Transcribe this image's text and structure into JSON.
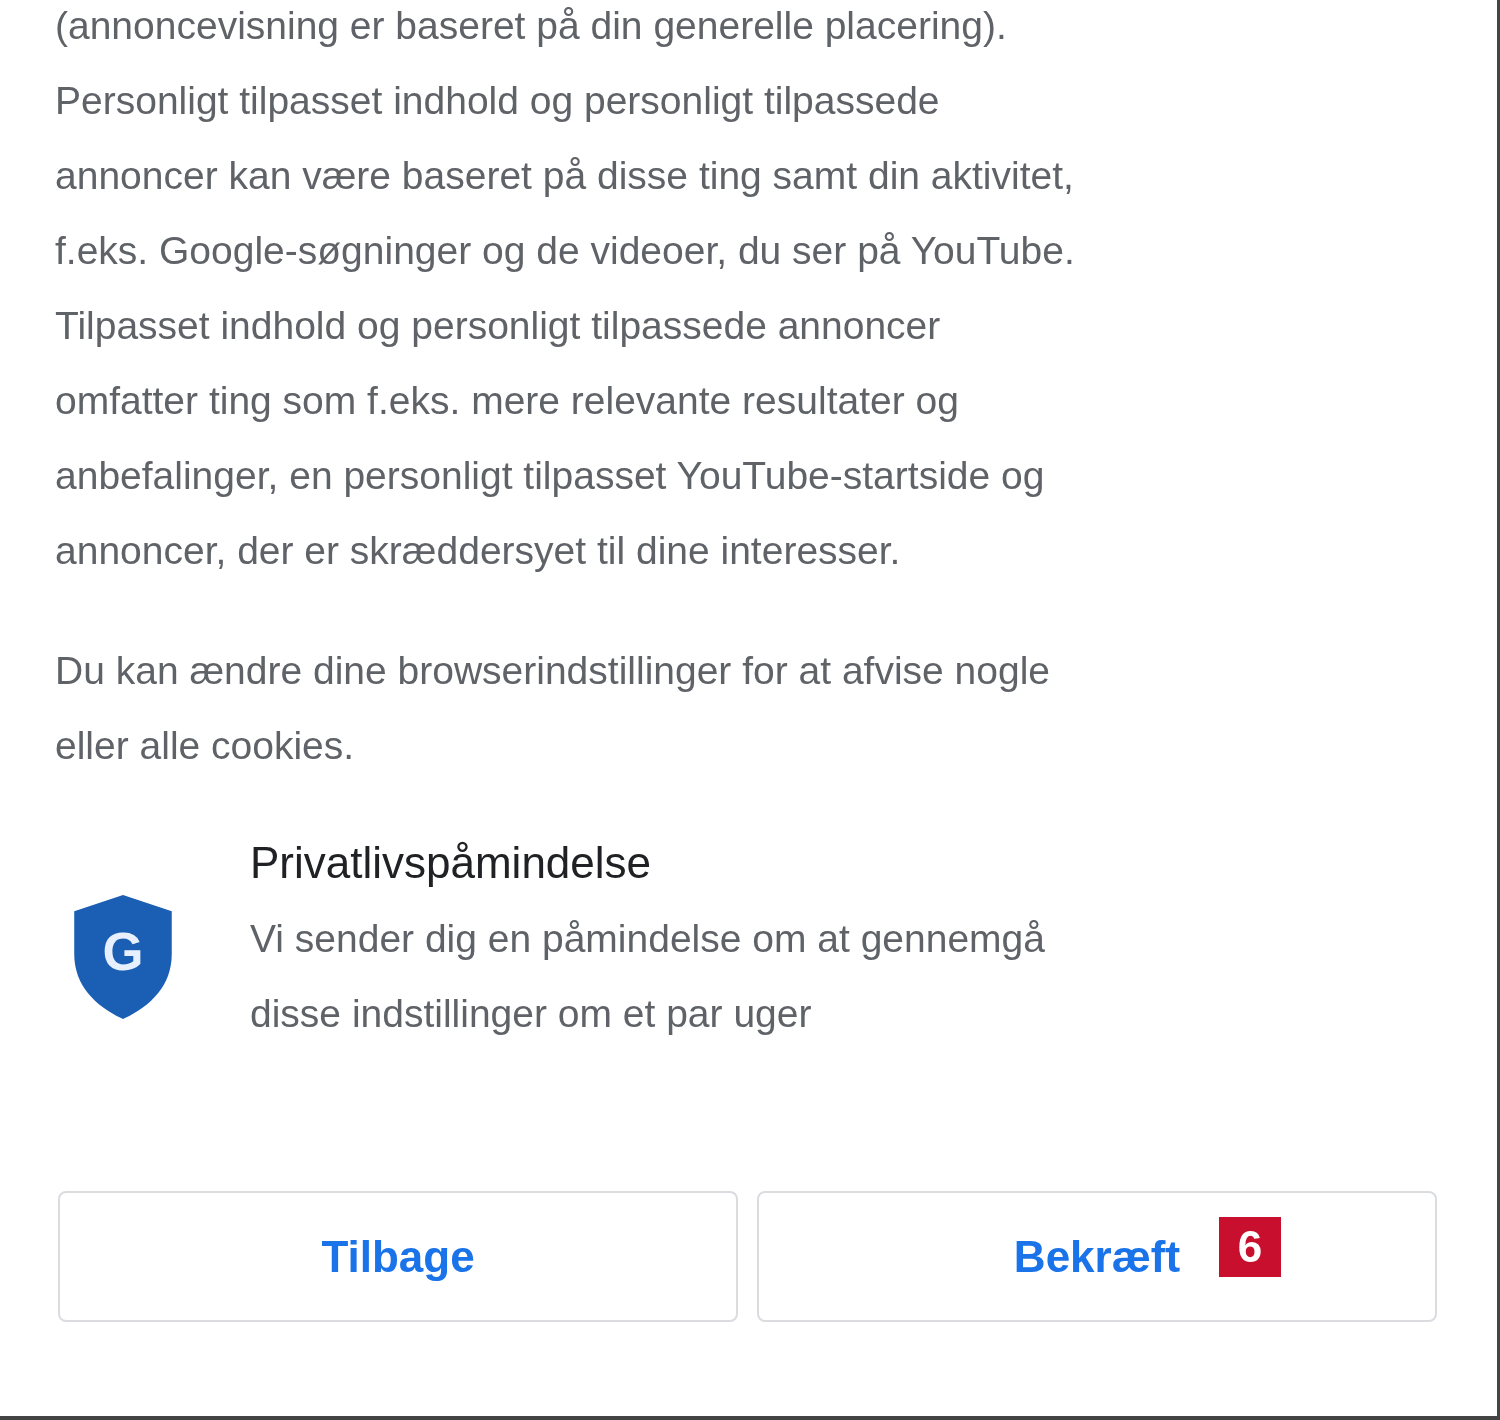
{
  "paragraphs": [
    {
      "lines": [
        "(annoncevisning er baseret på din generelle placering).",
        "Personligt tilpasset indhold og personligt tilpassede",
        "annoncer kan være baseret på disse ting samt din aktivitet,",
        "f.eks. Google-søgninger og de videoer, du ser på YouTube.",
        "Tilpasset indhold og personligt tilpassede annoncer",
        "omfatter ting som f.eks. mere relevante resultater og",
        "anbefalinger, en personligt tilpasset YouTube-startside og",
        "annoncer, der er skræddersyet til dine interesser."
      ]
    },
    {
      "lines": [
        "Du kan ændre dine browserindstillinger for at afvise nogle",
        "eller alle cookies."
      ]
    }
  ],
  "reminder": {
    "icon_letter": "G",
    "title": "Privatlivspåmindelse",
    "description_lines": [
      "Vi sender dig en påmindelse om at gennemgå",
      "disse indstillinger om et par uger"
    ]
  },
  "buttons": [
    {
      "label": "Tilbage"
    },
    {
      "label": "Bekræft",
      "badge": "6"
    }
  ]
}
